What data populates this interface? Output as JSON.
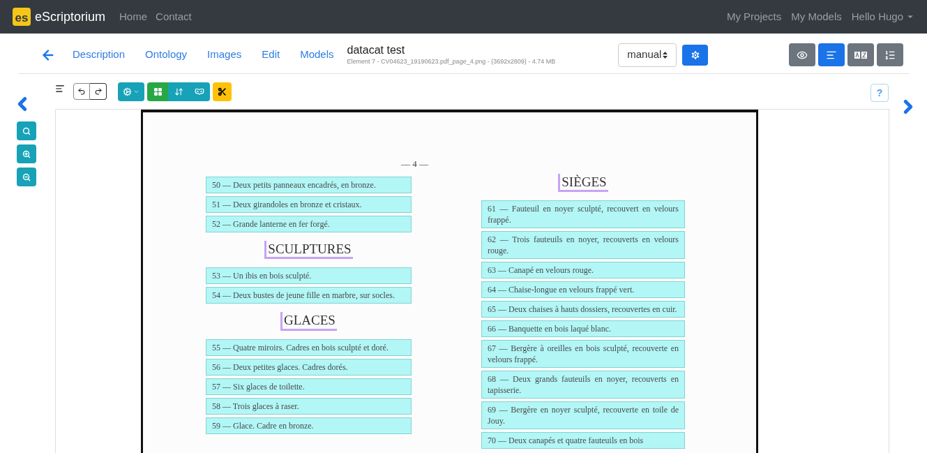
{
  "navbar": {
    "logo_text": "es",
    "brand": "eScriptorium",
    "links": [
      "Home",
      "Contact"
    ],
    "right_links": [
      "My Projects",
      "My Models"
    ],
    "user": "Hello Hugo"
  },
  "doc_tabs": [
    "Description",
    "Ontology",
    "Images",
    "Edit",
    "Models"
  ],
  "document": {
    "title": "datacat test",
    "subtitle": "Element 7 - CV04623_19190623.pdf_page_4.png - (3692x2809) - 4.74 MB"
  },
  "mode_select": {
    "value": "manual"
  },
  "view_buttons": [
    {
      "kind": "eye",
      "selected": false
    },
    {
      "kind": "lines",
      "selected": true
    },
    {
      "kind": "translate",
      "selected": false
    },
    {
      "kind": "list",
      "selected": false
    }
  ],
  "seg_tools": [
    {
      "kind": "regions",
      "selected": true
    },
    {
      "kind": "order",
      "selected": false
    },
    {
      "kind": "mask",
      "selected": false
    }
  ],
  "help_button": "?",
  "page": {
    "page_number": "— 4 —",
    "left_column": [
      {
        "kind": "line",
        "text": "50 — Deux petits panneaux encadrés, en bronze."
      },
      {
        "kind": "line",
        "text": "51 — Deux girandoles en bronze et cristaux."
      },
      {
        "kind": "line",
        "text": "52 — Grande lanterne en fer forgé."
      },
      {
        "kind": "heading",
        "text": "SCULPTURES"
      },
      {
        "kind": "line",
        "text": "53 — Un ibis en bois sculpté."
      },
      {
        "kind": "line",
        "text": "54 — Deux bustes de jeune fille en marbre, sur socles."
      },
      {
        "kind": "heading",
        "text": "GLACES"
      },
      {
        "kind": "line",
        "text": "55 — Quatre miroirs. Cadres en bois sculpté et doré."
      },
      {
        "kind": "line",
        "text": "56 — Deux petites glaces. Cadres dorés."
      },
      {
        "kind": "line",
        "text": "57 — Six glaces de toilette."
      },
      {
        "kind": "line",
        "text": "58 — Trois glaces à raser."
      },
      {
        "kind": "line",
        "text": "59 — Glace. Cadre en bronze."
      }
    ],
    "right_column": [
      {
        "kind": "heading",
        "text": "SIÈGES"
      },
      {
        "kind": "line",
        "text": "61 — Fauteuil en noyer sculpté, recouvert en velours frappé."
      },
      {
        "kind": "line",
        "text": "62 — Trois fauteuils en noyer, recouverts en velours rouge."
      },
      {
        "kind": "line",
        "text": "63 — Canapé en velours rouge."
      },
      {
        "kind": "line",
        "text": "64 — Chaise-longue en velours frappé vert."
      },
      {
        "kind": "line",
        "text": "65 — Deux chaises à hauts dossiers, recouvertes en cuir."
      },
      {
        "kind": "line",
        "text": "66 — Banquette en bois laqué blanc."
      },
      {
        "kind": "line",
        "text": "67 — Bergère à oreilles en bois sculpté, recouverte en velours frappé."
      },
      {
        "kind": "line",
        "text": "68 — Deux grands fauteuils en noyer, recouverts en tapisserie."
      },
      {
        "kind": "line",
        "text": "69 — Bergère en noyer sculpté, recouverte en toile de Jouy."
      },
      {
        "kind": "line",
        "text": "70 — Deux canapés et quatre fauteuils en bois"
      }
    ]
  }
}
